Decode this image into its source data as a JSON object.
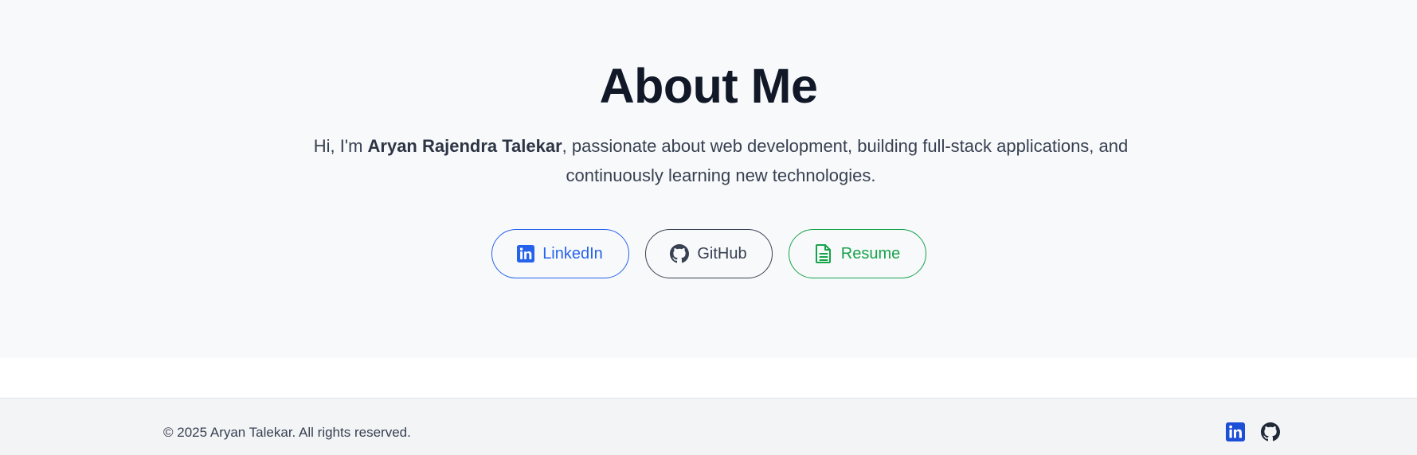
{
  "about": {
    "title": "About Me",
    "intro_prefix": "Hi, I'm ",
    "name": "Aryan Rajendra Talekar",
    "intro_suffix": ", passionate about web development, building full-stack applications, and continuously learning new technologies."
  },
  "buttons": {
    "linkedin": "LinkedIn",
    "github": "GitHub",
    "resume": "Resume"
  },
  "footer": {
    "copyright": "© 2025 Aryan Talekar. All rights reserved.",
    "icons": [
      "linkedin-icon",
      "github-icon"
    ]
  },
  "colors": {
    "linkedin": "#2563eb",
    "github": "#374151",
    "resume": "#16a34a",
    "heading": "#111827"
  }
}
